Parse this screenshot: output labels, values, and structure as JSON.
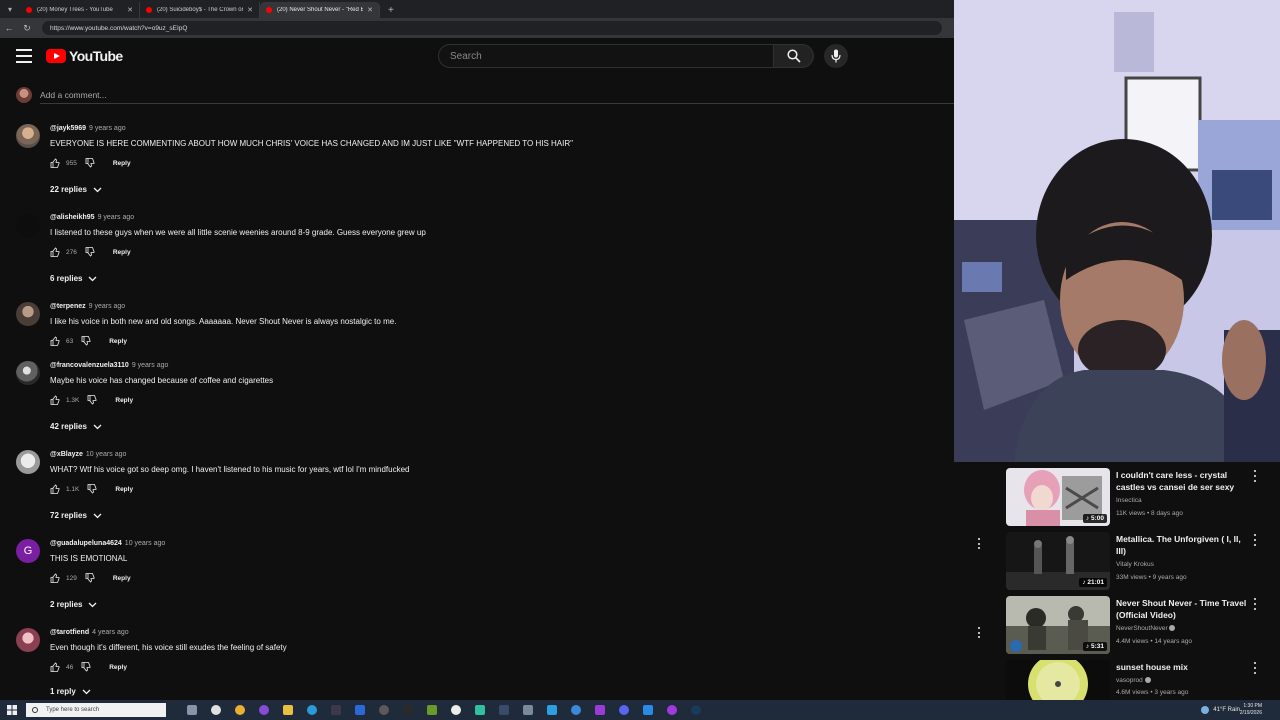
{
  "browser": {
    "tabs": [
      {
        "title": "(20) Money Trees - YouTube"
      },
      {
        "title": "(20) Suicideboy$ - The Crown on..."
      },
      {
        "title": "(20) Never Shout Never - \"Red Bu..."
      }
    ],
    "new_tab": "+",
    "url": "https://www.youtube.com/watch?v=o9uz_sEIpQ"
  },
  "header": {
    "logo_text": "YouTube",
    "search_placeholder": "Search"
  },
  "comments_section": {
    "add_comment_placeholder": "Add a comment...",
    "reply_label": "Reply",
    "comments": [
      {
        "handle": "@jayk5969",
        "age": "9 years ago",
        "text": "EVERYONE IS HERE COMMENTING ABOUT HOW MUCH CHRIS' VOICE HAS CHANGED AND IM JUST LIKE \"WTF HAPPENED TO HIS HAIR\"",
        "likes": "955",
        "replies": "22 replies"
      },
      {
        "handle": "@alisheikh95",
        "age": "9 years ago",
        "text": "I listened to these guys when we were all little scenie weenies around 8-9 grade. Guess everyone grew up",
        "likes": "276",
        "replies": "6 replies"
      },
      {
        "handle": "@terpenez",
        "age": "9 years ago",
        "text": "I like his voice in both new and old songs. Aaaaaaa. Never Shout Never is always nostalgic to me.",
        "likes": "63",
        "replies": ""
      },
      {
        "handle": "@francovalenzuela3110",
        "age": "9 years ago",
        "text": "Maybe his voice has changed because of coffee and cigarettes",
        "likes": "1.3K",
        "replies": "42 replies"
      },
      {
        "handle": "@xBlayze",
        "age": "10 years ago",
        "text": "WHAT? Wtf his voice got so deep omg. I haven't listened to his music for years, wtf lol I'm mindfucked",
        "likes": "1.1K",
        "replies": "72 replies"
      },
      {
        "handle": "@guadalupeluna4624",
        "age": "10 years ago",
        "text": "THIS IS EMOTIONAL",
        "likes": "129",
        "replies": "2 replies",
        "avatar_letter": "G"
      },
      {
        "handle": "@tarotfiend",
        "age": "4 years ago",
        "text": "Even though it's different, his voice still exudes the feeling of safety",
        "likes": "46",
        "replies": "1 reply"
      }
    ]
  },
  "recommendations": [
    {
      "title": "I couldn't care less - crystal castles vs cansei de ser sexy",
      "channel": "Insectica",
      "views": "11K views • 8 days ago",
      "duration": "♪ 5:00"
    },
    {
      "title": "Metallica.  The Unforgiven ( I, II, III)",
      "channel": "Vitaly Krokus",
      "views": "33M views • 9 years ago",
      "duration": "♪ 21:01"
    },
    {
      "title": "Never Shout Never - Time Travel (Official Video)",
      "channel": "NeverShoutNever",
      "views": "4.4M views • 14 years ago",
      "duration": "♪ 5:31"
    },
    {
      "title": "sunset house mix",
      "channel": "vasoprod",
      "views": "4.6M views • 3 years ago",
      "duration": ""
    }
  ],
  "taskbar": {
    "search_placeholder": "Type here to search",
    "weather": "41°F  Rain",
    "time": "1:30 PM",
    "date": "2/19/2026"
  },
  "colors": {
    "background": "#0f0f0f",
    "brand_red": "#ff0000",
    "secondary_text": "#aaaaaa"
  }
}
